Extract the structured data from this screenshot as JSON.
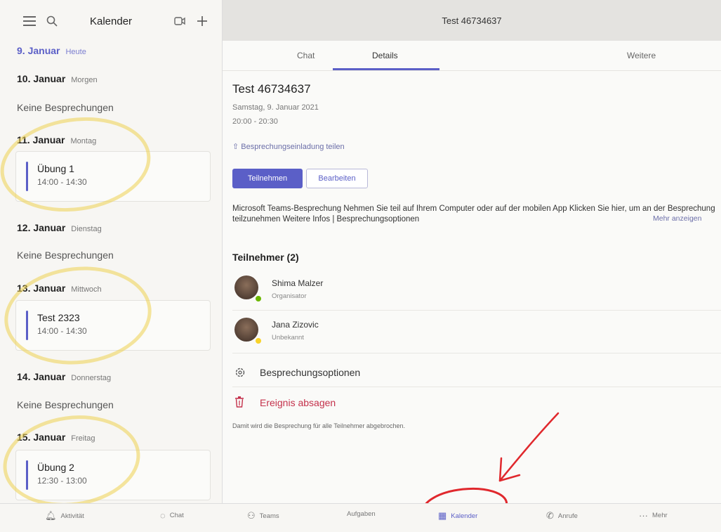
{
  "sidebar": {
    "title": "Kalender",
    "days": [
      {
        "date": "9. Januar",
        "weekday": "Heute"
      },
      {
        "date": "10. Januar",
        "weekday": "Morgen"
      },
      {
        "date": "11. Januar",
        "weekday": "Montag"
      },
      {
        "date": "12. Januar",
        "weekday": "Dienstag"
      },
      {
        "date": "13. Januar",
        "weekday": "Mittwoch"
      },
      {
        "date": "14. Januar",
        "weekday": "Donnerstag"
      },
      {
        "date": "15. Januar",
        "weekday": "Freitag"
      }
    ],
    "no_meetings": "Keine Besprechungen",
    "events": [
      {
        "title": "Übung 1",
        "time": "14:00 - 14:30"
      },
      {
        "title": "Test 2323",
        "time": "14:00 - 14:30"
      },
      {
        "title": "Übung 2",
        "time": "12:30 - 13:00"
      }
    ]
  },
  "header": {
    "title": "Test 46734637"
  },
  "tabs": [
    "Chat",
    "Details",
    "Weitere"
  ],
  "meeting": {
    "title": "Test 46734637",
    "date": "Samstag, 9. Januar 2021",
    "time": "20:00 - 20:30",
    "share_label": "Besprechungseinladung teilen",
    "join_label": "Teilnehmen",
    "edit_label": "Bearbeiten",
    "description": "Microsoft Teams-Besprechung Nehmen Sie teil auf Ihrem Computer oder auf der mobilen App Klicken Sie hier, um an der Besprechung teilzunehmen Weitere Infos | Besprechungsoptionen",
    "more_label": "Mehr anzeigen"
  },
  "participants": {
    "title": "Teilnehmer (2)",
    "list": [
      {
        "name": "Shima Malzer",
        "role": "Organisator"
      },
      {
        "name": "Jana Zizovic",
        "role": "Unbekannt"
      }
    ]
  },
  "options_label": "Besprechungsoptionen",
  "cancel": {
    "label": "Ereignis absagen",
    "note": "Damit wird die Besprechung für alle Teilnehmer abgebrochen."
  },
  "nav": [
    "Aktivität",
    "Chat",
    "Teams",
    "Aufgaben",
    "Kalender",
    "Anrufe",
    "Mehr"
  ],
  "colors": {
    "accent": "#5b5fc7",
    "danger": "#c4314b",
    "highlight": "#eed250",
    "annotation": "#e0282d"
  }
}
